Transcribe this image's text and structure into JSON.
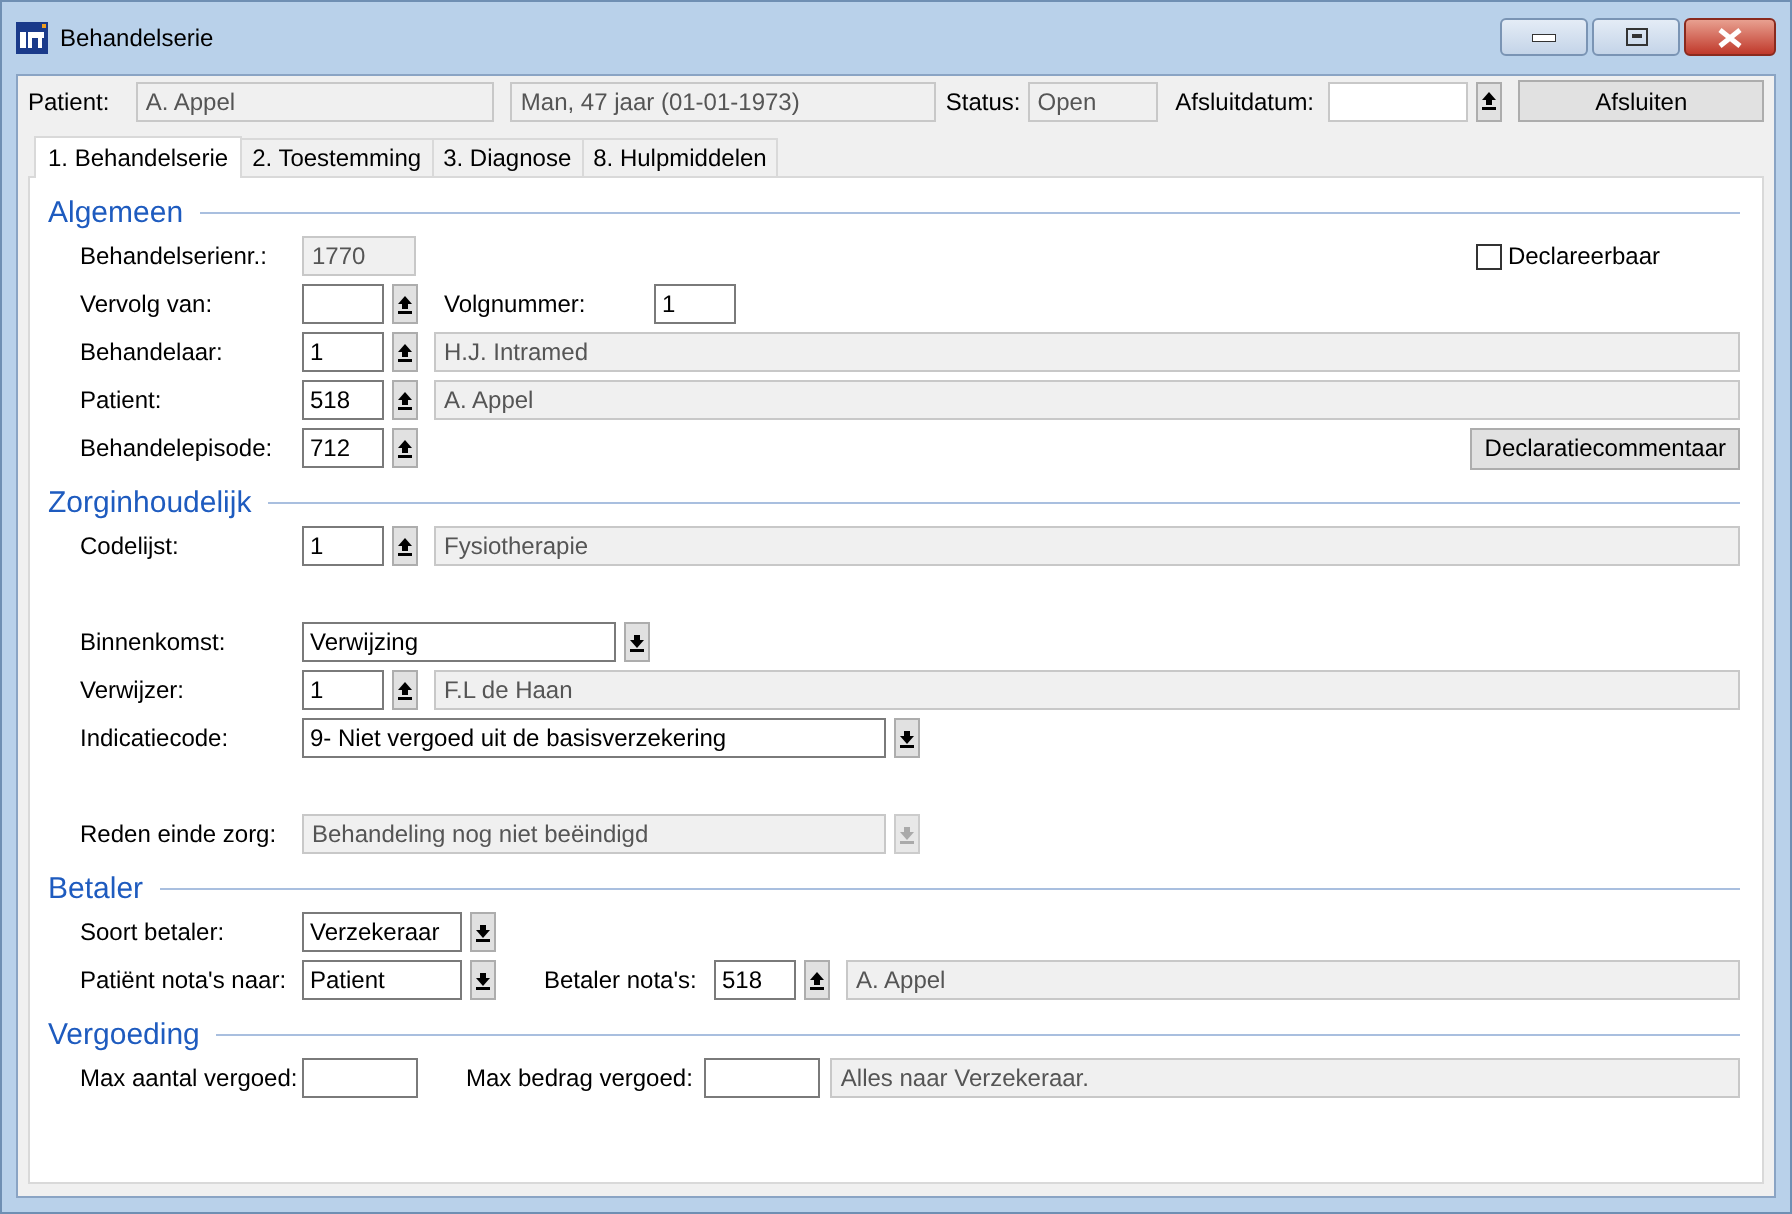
{
  "window": {
    "title": "Behandelserie"
  },
  "header": {
    "patient_label": "Patient:",
    "patient_name": "A. Appel",
    "patient_info": "Man, 47 jaar (01-01-1973)",
    "status_label": "Status:",
    "status": "Open",
    "closing_date_label": "Afsluitdatum:",
    "close_button": "Afsluiten"
  },
  "tabs": [
    {
      "label": "1. Behandelserie",
      "selected": true
    },
    {
      "label": "2. Toestemming",
      "selected": false
    },
    {
      "label": "3. Diagnose",
      "selected": false
    },
    {
      "label": "8. Hulpmiddelen",
      "selected": false
    }
  ],
  "sections": [
    {
      "title": "Algemeen",
      "groups": [
        [
          {
            "label": "Behandelserienr.:",
            "controls": [
              {
                "kind": "readonly",
                "value": "1770"
              },
              {
                "kind": "checkbox",
                "text": "Declareerbaar",
                "checked": false
              }
            ]
          },
          {
            "label": "Vervolg van:",
            "controls": [
              {
                "kind": "code"
              },
              {
                "kind": "lookup"
              },
              {
                "kind": "label",
                "text": "Volgnummer:"
              },
              {
                "kind": "code",
                "value": "1"
              }
            ]
          },
          {
            "label": "Behandelaar:",
            "controls": [
              {
                "kind": "code",
                "value": "1"
              },
              {
                "kind": "lookup"
              },
              {
                "kind": "description",
                "value": "H.J. Intramed"
              }
            ]
          },
          {
            "label": "Patient:",
            "controls": [
              {
                "kind": "code",
                "value": "518"
              },
              {
                "kind": "lookup"
              },
              {
                "kind": "description",
                "value": "A. Appel"
              }
            ]
          },
          {
            "label": "Behandelepisode:",
            "controls": [
              {
                "kind": "code",
                "value": "712"
              },
              {
                "kind": "lookup"
              },
              {
                "kind": "button",
                "text": "Declaratiecommentaar"
              }
            ]
          }
        ]
      ]
    },
    {
      "title": "Zorginhoudelijk",
      "groups": [
        [
          {
            "label": "Codelijst:",
            "controls": [
              {
                "kind": "code",
                "value": "1"
              },
              {
                "kind": "lookup"
              },
              {
                "kind": "description",
                "value": "Fysiotherapie"
              }
            ]
          }
        ],
        [
          {
            "label": "Binnenkomst:",
            "controls": [
              {
                "kind": "combo",
                "value": "Verwijzing",
                "disabled": false
              }
            ]
          },
          {
            "label": "Verwijzer:",
            "controls": [
              {
                "kind": "code",
                "value": "1"
              },
              {
                "kind": "lookup"
              },
              {
                "kind": "description",
                "value": "F.L de Haan"
              }
            ]
          },
          {
            "label": "Indicatiecode:",
            "controls": [
              {
                "kind": "longcombo",
                "value": "9- Niet vergoed uit de basisverzekering",
                "disabled": false
              }
            ]
          }
        ],
        [
          {
            "label": "Reden einde zorg:",
            "controls": [
              {
                "kind": "longcombo",
                "value": "Behandeling nog niet beëindigd",
                "disabled": true
              }
            ]
          }
        ]
      ]
    },
    {
      "title": "Betaler",
      "groups": [
        [
          {
            "label": "Soort betaler:",
            "controls": [
              {
                "kind": "select",
                "value": "Verzekeraar",
                "disabled": false
              }
            ]
          },
          {
            "label": "Patiënt nota's naar:",
            "controls": [
              {
                "kind": "select",
                "value": "Patient",
                "disabled": false
              },
              {
                "kind": "label",
                "text": "Betaler nota's:"
              },
              {
                "kind": "code",
                "value": "518"
              },
              {
                "kind": "lookup"
              },
              {
                "kind": "description",
                "value": "A. Appel"
              }
            ]
          }
        ]
      ]
    },
    {
      "title": "Vergoeding",
      "groups": [
        [
          {
            "label": "Max aantal vergoed:",
            "controls": [
              {
                "kind": "amount"
              },
              {
                "kind": "label",
                "text": "Max bedrag vergoed:"
              },
              {
                "kind": "amount"
              },
              {
                "kind": "description",
                "value": "Alles naar Verzekeraar."
              }
            ]
          }
        ]
      ]
    }
  ]
}
